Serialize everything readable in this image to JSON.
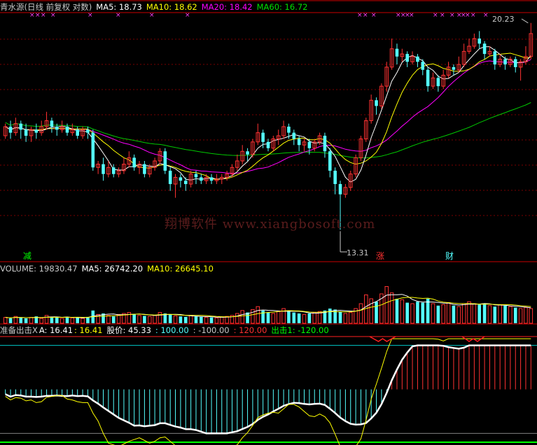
{
  "colors": {
    "bg": "#000000",
    "up": "#ff3232",
    "down": "#54ffff",
    "ma5": "#ffffff",
    "ma10": "#ffff00",
    "ma20": "#ff00ff",
    "ma60": "#00c800",
    "grid": "#7a0000",
    "sep": "#c80000",
    "cyanline": "#00c8c8",
    "redline": "#ff2020",
    "greenline": "#00ff00"
  },
  "header": {
    "title": "青水源(日线 前复权 对数)",
    "ma5": "MA5: 18.73",
    "ma10": "MA10: 18.62",
    "ma20": "MA20: 18.42",
    "ma60": "MA60: 16.72"
  },
  "markers": {
    "high_label": "20.23",
    "low_label": "13.31",
    "tag_jian": "减",
    "tag_zhang": "涨",
    "tag_cai": "财",
    "x_marks_top": "×"
  },
  "watermark": "翔博软件 www.xiangbosoft.com",
  "volume_header": {
    "label": "VOLUME: 19830.47",
    "ma5": "MA5: 26742.20",
    "ma10": "MA10: 26645.10"
  },
  "indicator_header": {
    "name": "准备出击X",
    "a": "A: 16.41",
    "v2": ": 16.41",
    "price": "股价: 45.33",
    "l100": ": 100.00",
    "lm100": ": -100.00",
    "l120": ": 120.00",
    "chuji": "出击1: -120.00"
  },
  "chart_data": {
    "type": "candlestick",
    "price_range": [
      13.31,
      20.23
    ],
    "candles": [
      [
        16.1,
        16.4,
        16.5,
        16.0
      ],
      [
        16.4,
        16.2,
        16.6,
        16.0
      ],
      [
        16.2,
        16.5,
        16.7,
        16.1
      ],
      [
        16.5,
        16.3,
        16.6,
        16.0
      ],
      [
        16.3,
        16.1,
        16.5,
        15.9
      ],
      [
        16.1,
        16.3,
        16.4,
        15.9
      ],
      [
        16.3,
        16.2,
        16.5,
        16.0
      ],
      [
        16.2,
        16.4,
        16.6,
        16.1
      ],
      [
        16.4,
        16.6,
        16.9,
        16.3
      ],
      [
        16.6,
        16.4,
        16.7,
        16.2
      ],
      [
        16.4,
        16.3,
        16.5,
        16.1
      ],
      [
        16.3,
        16.4,
        16.6,
        16.2
      ],
      [
        16.4,
        16.2,
        16.5,
        16.1
      ],
      [
        16.2,
        16.3,
        16.5,
        16.1
      ],
      [
        16.3,
        16.1,
        16.4,
        16.0
      ],
      [
        16.1,
        16.3,
        16.4,
        16.0
      ],
      [
        16.3,
        16.2,
        16.4,
        16.0
      ],
      [
        16.2,
        15.1,
        16.3,
        15.0
      ],
      [
        15.1,
        15.2,
        15.3,
        14.9
      ],
      [
        15.2,
        14.9,
        15.4,
        14.7
      ],
      [
        14.9,
        15.1,
        15.3,
        14.8
      ],
      [
        15.1,
        14.9,
        15.2,
        14.8
      ],
      [
        14.9,
        15.0,
        15.1,
        14.8
      ],
      [
        15.0,
        15.2,
        15.4,
        14.9
      ],
      [
        15.2,
        15.4,
        15.6,
        15.1
      ],
      [
        15.4,
        15.1,
        15.5,
        15.0
      ],
      [
        15.1,
        15.2,
        15.3,
        14.9
      ],
      [
        15.2,
        14.9,
        15.3,
        14.8
      ],
      [
        14.9,
        15.1,
        15.2,
        14.8
      ],
      [
        15.1,
        15.3,
        15.4,
        15.0
      ],
      [
        15.3,
        15.6,
        15.7,
        15.2
      ],
      [
        15.6,
        15.0,
        15.7,
        14.9
      ],
      [
        15.0,
        14.6,
        15.1,
        14.4
      ],
      [
        14.6,
        14.8,
        14.9,
        14.2
      ],
      [
        14.8,
        14.7,
        14.9,
        14.5
      ],
      [
        14.7,
        14.6,
        14.8,
        14.4
      ],
      [
        14.6,
        14.9,
        15.0,
        14.5
      ],
      [
        14.9,
        14.8,
        15.0,
        14.6
      ],
      [
        14.8,
        14.7,
        14.9,
        14.6
      ],
      [
        14.7,
        14.8,
        14.9,
        14.6
      ],
      [
        14.8,
        14.7,
        14.9,
        14.6
      ],
      [
        14.7,
        14.75,
        14.9,
        14.6
      ],
      [
        14.75,
        14.8,
        14.9,
        14.6
      ],
      [
        14.8,
        14.9,
        15.0,
        14.7
      ],
      [
        14.9,
        15.1,
        15.2,
        14.8
      ],
      [
        15.1,
        15.3,
        15.5,
        15.0
      ],
      [
        15.3,
        15.6,
        15.8,
        15.2
      ],
      [
        15.6,
        15.5,
        15.7,
        15.3
      ],
      [
        15.5,
        15.9,
        16.0,
        15.4
      ],
      [
        15.9,
        16.2,
        16.5,
        15.8
      ],
      [
        16.2,
        15.9,
        16.3,
        15.7
      ],
      [
        15.9,
        15.7,
        16.0,
        15.6
      ],
      [
        15.7,
        16.0,
        16.1,
        15.6
      ],
      [
        16.0,
        16.1,
        16.3,
        15.8
      ],
      [
        16.1,
        16.4,
        16.6,
        16.0
      ],
      [
        16.4,
        16.2,
        16.5,
        16.0
      ],
      [
        16.2,
        16.0,
        16.3,
        15.8
      ],
      [
        16.0,
        15.8,
        16.1,
        15.6
      ],
      [
        15.8,
        15.9,
        16.0,
        15.6
      ],
      [
        15.9,
        15.7,
        16.0,
        15.5
      ],
      [
        15.7,
        15.9,
        16.0,
        15.6
      ],
      [
        15.9,
        16.1,
        16.2,
        15.8
      ],
      [
        16.1,
        15.6,
        16.2,
        15.4
      ],
      [
        15.6,
        15.0,
        15.7,
        14.8
      ],
      [
        15.0,
        14.6,
        15.1,
        14.3
      ],
      [
        14.6,
        14.3,
        14.7,
        13.31
      ],
      [
        14.3,
        14.5,
        14.6,
        14.2
      ],
      [
        14.5,
        14.9,
        15.0,
        14.4
      ],
      [
        14.9,
        15.4,
        15.5,
        14.8
      ],
      [
        15.4,
        16.0,
        16.1,
        15.3
      ],
      [
        16.0,
        16.6,
        16.7,
        15.9
      ],
      [
        16.6,
        17.3,
        17.5,
        16.5
      ],
      [
        17.3,
        17.1,
        17.4,
        16.8
      ],
      [
        17.1,
        17.8,
        17.9,
        17.0
      ],
      [
        17.8,
        18.5,
        18.7,
        17.6
      ],
      [
        18.5,
        19.2,
        19.6,
        18.4
      ],
      [
        19.2,
        18.9,
        19.4,
        18.6
      ],
      [
        18.9,
        19.0,
        19.2,
        18.7
      ],
      [
        19.0,
        18.7,
        19.1,
        18.5
      ],
      [
        18.7,
        18.9,
        19.1,
        18.6
      ],
      [
        18.9,
        18.7,
        19.0,
        18.5
      ],
      [
        18.7,
        18.4,
        18.8,
        18.2
      ],
      [
        18.4,
        17.8,
        18.5,
        17.6
      ],
      [
        17.8,
        18.1,
        18.3,
        17.7
      ],
      [
        18.1,
        17.8,
        18.2,
        17.6
      ],
      [
        17.8,
        18.2,
        18.4,
        17.7
      ],
      [
        18.2,
        18.5,
        18.7,
        18.1
      ],
      [
        18.5,
        18.4,
        18.6,
        18.2
      ],
      [
        18.4,
        18.6,
        18.9,
        18.3
      ],
      [
        18.6,
        19.1,
        19.4,
        18.5
      ],
      [
        19.1,
        19.3,
        19.6,
        19.0
      ],
      [
        19.3,
        19.6,
        19.8,
        19.2
      ],
      [
        19.6,
        19.4,
        19.9,
        19.2
      ],
      [
        19.4,
        19.0,
        19.5,
        18.8
      ],
      [
        19.0,
        19.1,
        19.3,
        18.9
      ],
      [
        19.1,
        18.6,
        19.2,
        18.4
      ],
      [
        18.6,
        18.8,
        19.0,
        18.5
      ],
      [
        18.8,
        18.6,
        18.9,
        18.4
      ],
      [
        18.6,
        18.8,
        18.9,
        18.5
      ],
      [
        18.8,
        18.5,
        18.9,
        18.3
      ],
      [
        18.5,
        18.7,
        18.8,
        18.0
      ],
      [
        18.7,
        18.9,
        19.3,
        18.6
      ],
      [
        18.9,
        19.8,
        20.23,
        18.8
      ]
    ],
    "volume": [
      0.12,
      0.1,
      0.14,
      0.11,
      0.1,
      0.12,
      0.14,
      0.1,
      0.16,
      0.13,
      0.12,
      0.1,
      0.13,
      0.11,
      0.12,
      0.1,
      0.13,
      0.26,
      0.18,
      0.2,
      0.16,
      0.14,
      0.18,
      0.2,
      0.22,
      0.18,
      0.16,
      0.15,
      0.14,
      0.16,
      0.22,
      0.2,
      0.18,
      0.15,
      0.14,
      0.13,
      0.16,
      0.14,
      0.13,
      0.12,
      0.12,
      0.11,
      0.13,
      0.14,
      0.16,
      0.2,
      0.26,
      0.22,
      0.28,
      0.34,
      0.26,
      0.22,
      0.2,
      0.24,
      0.3,
      0.26,
      0.22,
      0.2,
      0.18,
      0.2,
      0.22,
      0.24,
      0.26,
      0.3,
      0.28,
      0.24,
      0.2,
      0.22,
      0.3,
      0.4,
      0.58,
      0.5,
      0.44,
      0.6,
      0.75,
      0.62,
      0.5,
      0.48,
      0.42,
      0.4,
      0.44,
      0.42,
      0.5,
      0.4,
      0.36,
      0.38,
      0.42,
      0.36,
      0.34,
      0.4,
      0.44,
      0.4,
      0.38,
      0.4,
      0.36,
      0.34,
      0.38,
      0.36,
      0.34,
      0.32,
      0.3,
      0.32,
      0.3
    ]
  }
}
